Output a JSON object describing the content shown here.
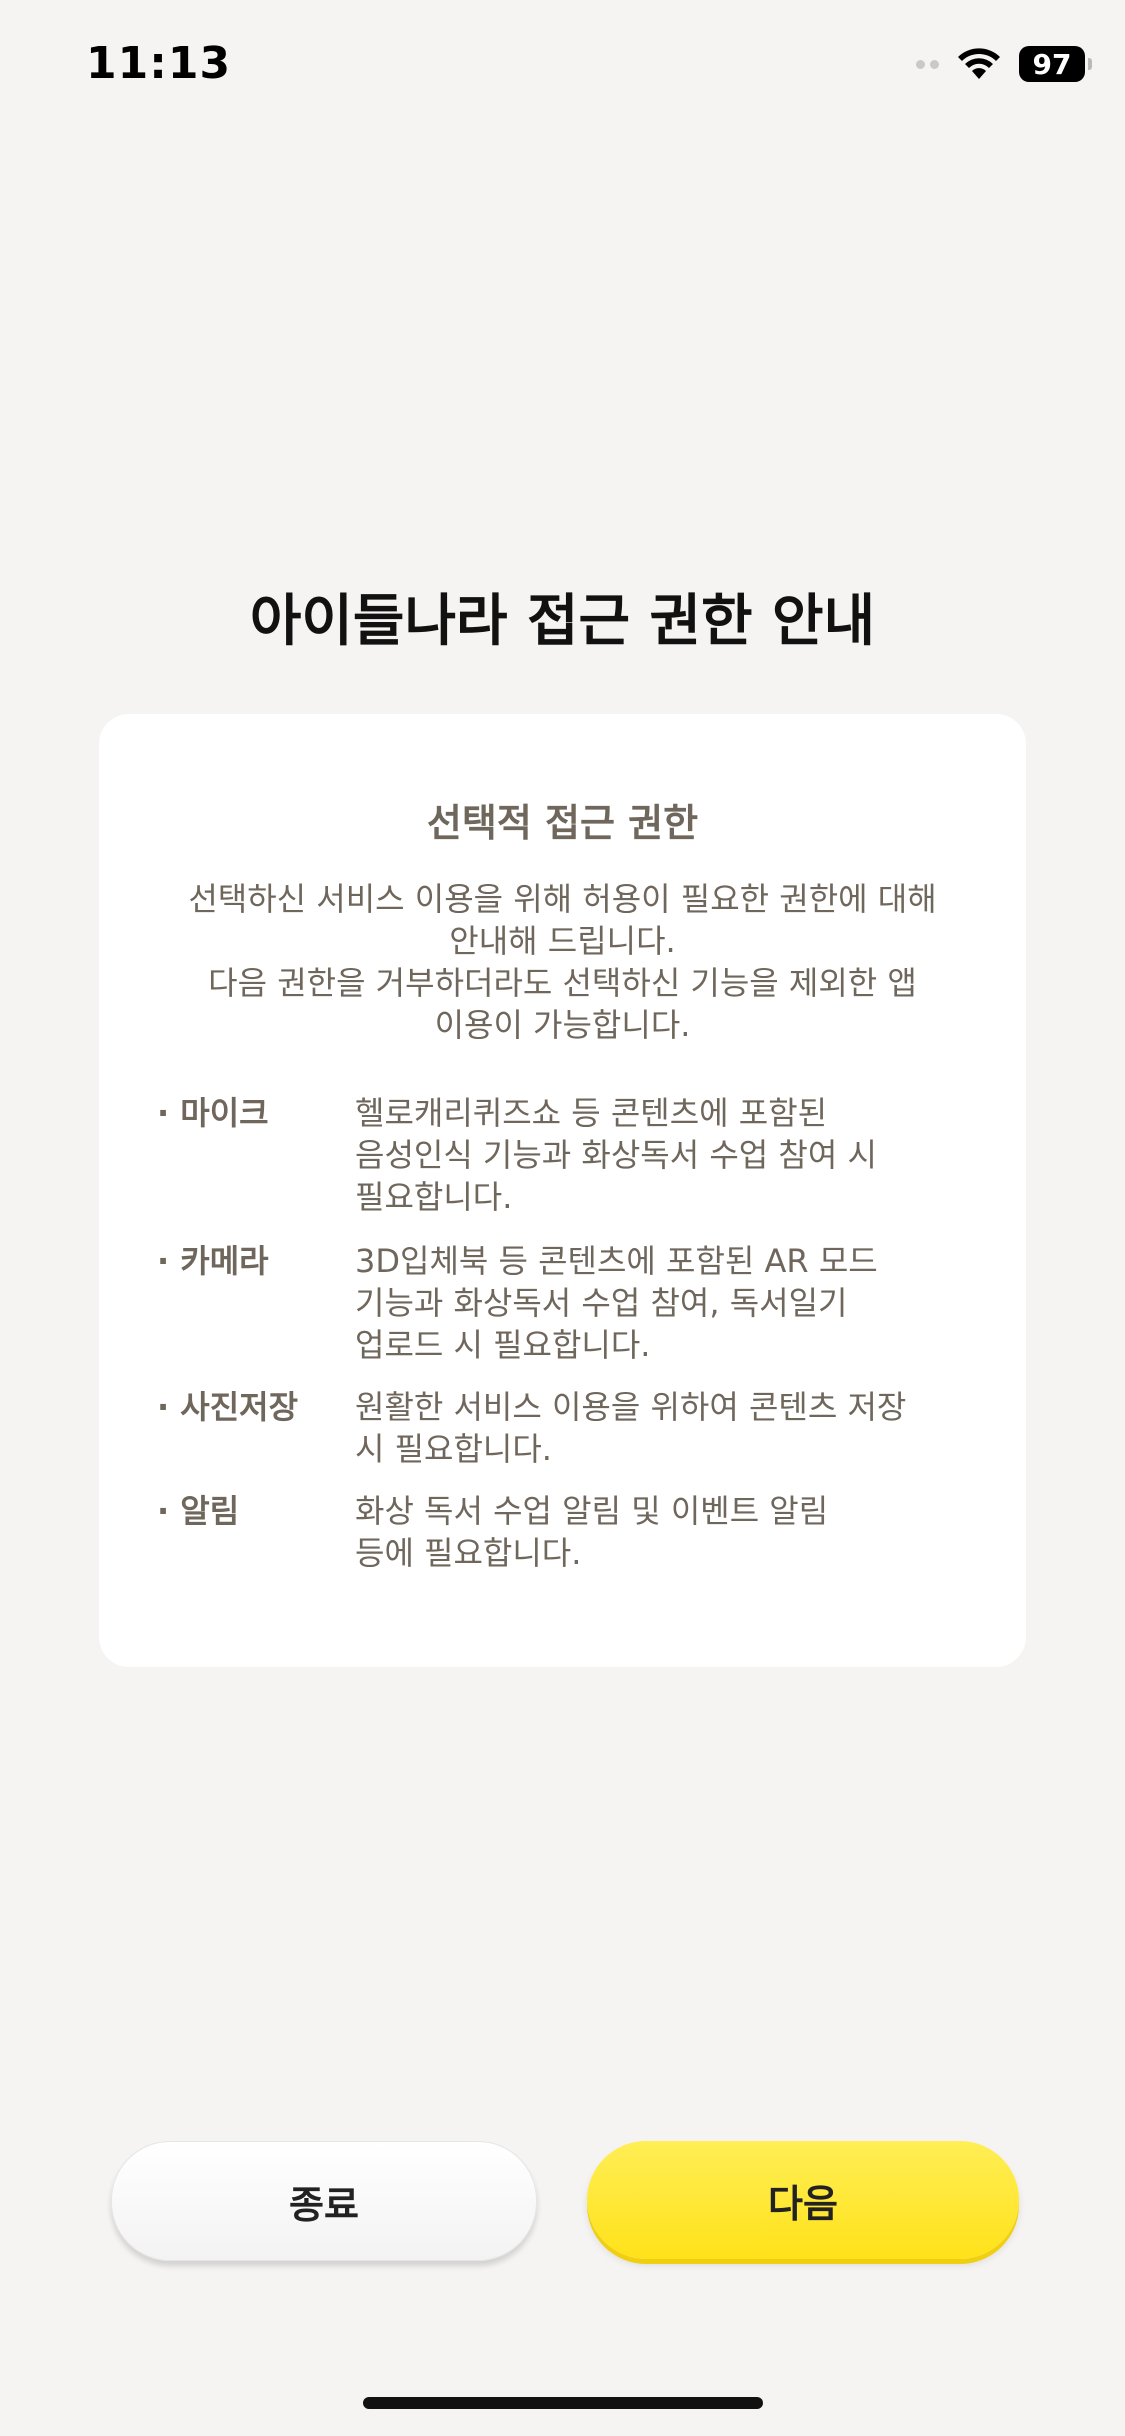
{
  "status_bar": {
    "time": "11:13",
    "battery": "97",
    "icons": [
      "cellular-dots-icon",
      "wifi-icon",
      "battery-icon"
    ]
  },
  "title": "아이들나라 접근 권한 안내",
  "card": {
    "title": "선택적 접근 권한",
    "description_lines": [
      "선택하신 서비스 이용을 위해 허용이 필요한 권한에 대해",
      "안내해 드립니다.",
      "다음 권한을 거부하더라도 선택하신 기능을 제외한 앱",
      "이용이 가능합니다."
    ],
    "permissions": [
      {
        "name": "· 마이크",
        "lines": [
          "헬로캐리퀴즈쇼 등 콘텐츠에 포함된",
          "음성인식 기능과 화상독서 수업 참여 시",
          "필요합니다."
        ]
      },
      {
        "name": "· 카메라",
        "lines": [
          "3D입체북 등 콘텐츠에 포함된 AR 모드",
          "기능과 화상독서 수업 참여, 독서일기",
          "업로드 시 필요합니다."
        ]
      },
      {
        "name": "· 사진저장",
        "lines": [
          "원활한 서비스 이용을 위하여 콘텐츠 저장",
          "시 필요합니다."
        ]
      },
      {
        "name": "· 알림",
        "lines": [
          "화상 독서 수업 알림 및 이벤트 알림",
          "등에 필요합니다."
        ]
      }
    ]
  },
  "buttons": {
    "exit_label": "종료",
    "next_label": "다음"
  },
  "colors": {
    "background": "#f5f4f2",
    "card_text": "#6f665c",
    "accent_yellow": "#ffe21a"
  }
}
